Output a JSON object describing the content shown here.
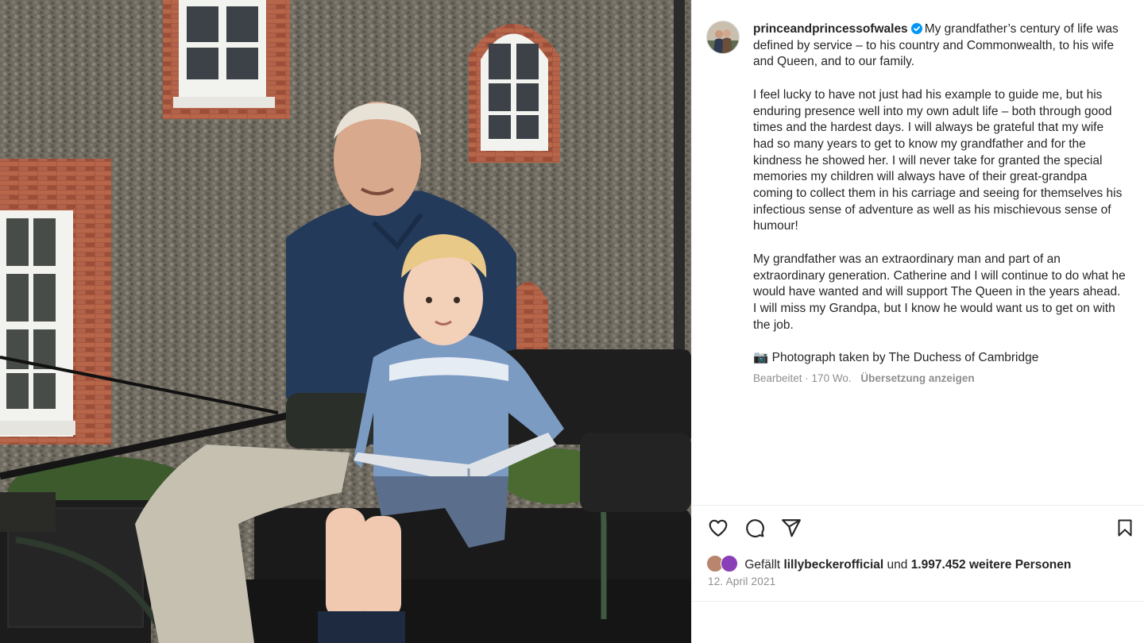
{
  "post": {
    "username": "princeandprincessofwales",
    "verified_icon": "verified-badge-icon",
    "accent_color": "#0095f6",
    "caption_paragraphs": [
      "My grandfather’s century of life was defined by service – to his country and Commonwealth, to his wife and Queen, and to our family.",
      "I feel lucky to have not just had his example to guide me, but his enduring presence well into my own adult life – both through good times and the hardest days. I will always be grateful that my wife had so many years to get to know my grandfather and for the kindness he showed her. I will never take for granted the special memories my children will always have of their great-grandpa coming to collect them in his carriage and seeing for themselves his infectious sense of adventure as well as his mischievous sense of humour!",
      "My grandfather was an extraordinary man and part of an extraordinary generation. Catherine and I will continue to do what he would have wanted and will support The Queen in the years ahead. I will miss my Grandpa, but I know he would want us to get on with the job.",
      "📷 Photograph taken by The Duchess of Cambridge"
    ],
    "edited_label": "Bearbeitet",
    "age": "170 Wo.",
    "translate_label": "Übersetzung anzeigen"
  },
  "actions": {
    "like_icon": "heart-icon",
    "comment_icon": "comment-icon",
    "share_icon": "send-icon",
    "save_icon": "bookmark-icon"
  },
  "likes": {
    "prefix": "Gefällt",
    "user": "lillybeckerofficial",
    "connector": "und",
    "count": "1.997.452 weitere Personen"
  },
  "date": "12. April 2021"
}
